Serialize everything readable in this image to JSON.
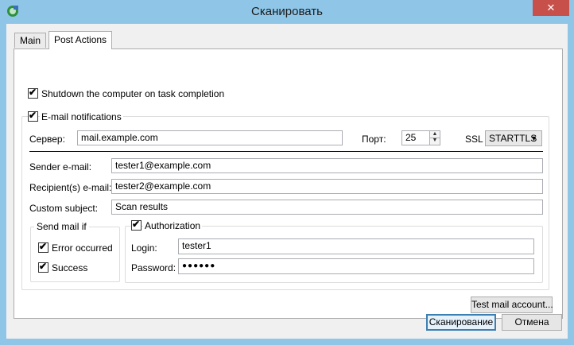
{
  "window": {
    "title": "Сканировать",
    "close_glyph": "✕"
  },
  "tabs": [
    {
      "label": "Main"
    },
    {
      "label": "Post Actions"
    }
  ],
  "post_actions": {
    "shutdown": {
      "label": "Shutdown the computer on task completion",
      "checked": true
    },
    "email": {
      "label": "E-mail notifications",
      "checked": true,
      "server_label": "Сервер:",
      "server_value": "mail.example.com",
      "port_label": "Порт:",
      "port_value": "25",
      "ssl_label": "SSL",
      "ssl_value": "STARTTLS",
      "sender_label": "Sender e-mail:",
      "sender_value": "tester1@example.com",
      "recipient_label": "Recipient(s) e-mail:",
      "recipient_value": "tester2@example.com",
      "subject_label": "Custom subject:",
      "subject_value": "Scan results",
      "send_if": {
        "title": "Send mail if",
        "error": {
          "label": "Error occurred",
          "checked": true
        },
        "success": {
          "label": "Success",
          "checked": true
        }
      },
      "auth": {
        "label": "Authorization",
        "checked": true,
        "login_label": "Login:",
        "login_value": "tester1",
        "password_label": "Password:",
        "password_value": "●●●●●●"
      },
      "test_button": "Test mail account..."
    }
  },
  "footer": {
    "scan_button": "Сканирование",
    "cancel_button": "Отмена"
  },
  "icons": {
    "check": "✔",
    "spin_up": "▲",
    "spin_down": "▼",
    "dropdown": "▼"
  }
}
